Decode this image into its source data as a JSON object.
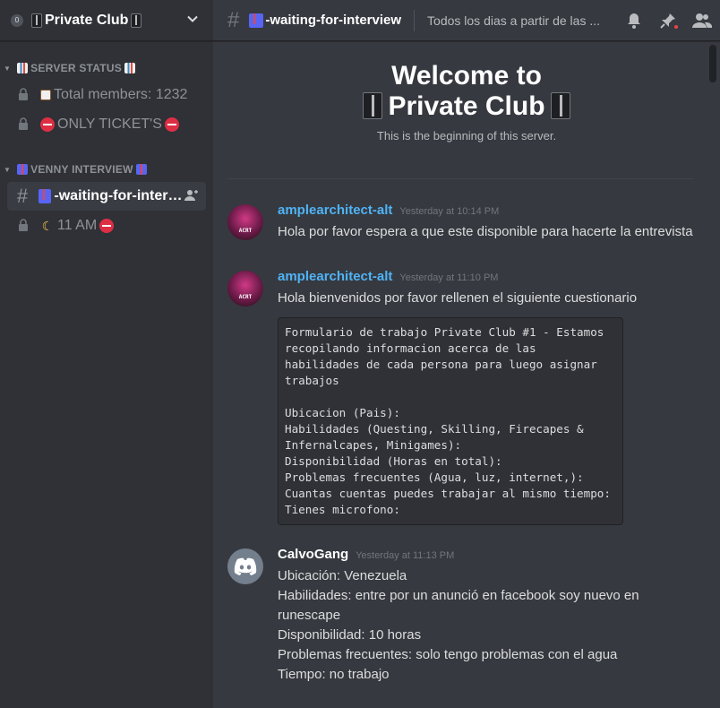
{
  "server": {
    "badge": "0",
    "name": "Private Club",
    "menu_icon": "chevron-down-icon"
  },
  "sidebar": {
    "categories": [
      {
        "label": "SERVER STATUS",
        "channels": [
          {
            "label": "Total members: 1232",
            "locked": true
          },
          {
            "label": "ONLY TICKET'S",
            "locked": true
          }
        ]
      },
      {
        "label": "VENNY INTERVIEW",
        "channels": [
          {
            "label": "-waiting-for-interview",
            "active": true,
            "invite_icon": "add-member-icon"
          },
          {
            "label": "11 AM",
            "locked": true
          }
        ]
      }
    ]
  },
  "topbar": {
    "channel_name": "-waiting-for-interview",
    "topic": "Todos los dias a partir de las ..."
  },
  "welcome": {
    "line1": "Welcome to",
    "line2": "Private Club",
    "subtitle": "This is the beginning of this server."
  },
  "messages": [
    {
      "author": "amplearchitect-alt",
      "timestamp": "Yesterday at 10:14 PM",
      "avatar_text": "ACRT",
      "lines": [
        "Hola por favor espera a que este disponible para hacerte la entrevista"
      ]
    },
    {
      "author": "amplearchitect-alt",
      "timestamp": "Yesterday at 11:10 PM",
      "avatar_text": "ACRT",
      "lines": [
        "Hola bienvenidos por favor rellenen el siguiente cuestionario"
      ],
      "code": "Formulario de trabajo Private Club #1 - Estamos\nrecopilando informacion acerca de las\nhabilidades de cada persona para luego asignar\ntrabajos\n\nUbicacion (Pais):\nHabilidades (Questing, Skilling, Firecapes &\nInfernalcapes, Minigames):\nDisponibilidad (Horas en total):\nProblemas frecuentes (Agua, luz, internet,):\nCuantas cuentas puedes trabajar al mismo tiempo:\nTienes microfono:"
    },
    {
      "author": "CalvoGang",
      "timestamp": "Yesterday at 11:13 PM",
      "lines": [
        "Ubicación: Venezuela",
        "Habilidades: entre por un anunció en facebook soy nuevo en runescape",
        "Disponibilidad: 10 horas",
        "Problemas frecuentes: solo tengo problemas con el agua",
        "Tiempo: no trabajo"
      ]
    }
  ],
  "colors": {
    "sidebar_bg": "#2f3136",
    "chat_bg": "#36393f",
    "author_link": "#4fb3f6",
    "muted": "#8e9297"
  }
}
